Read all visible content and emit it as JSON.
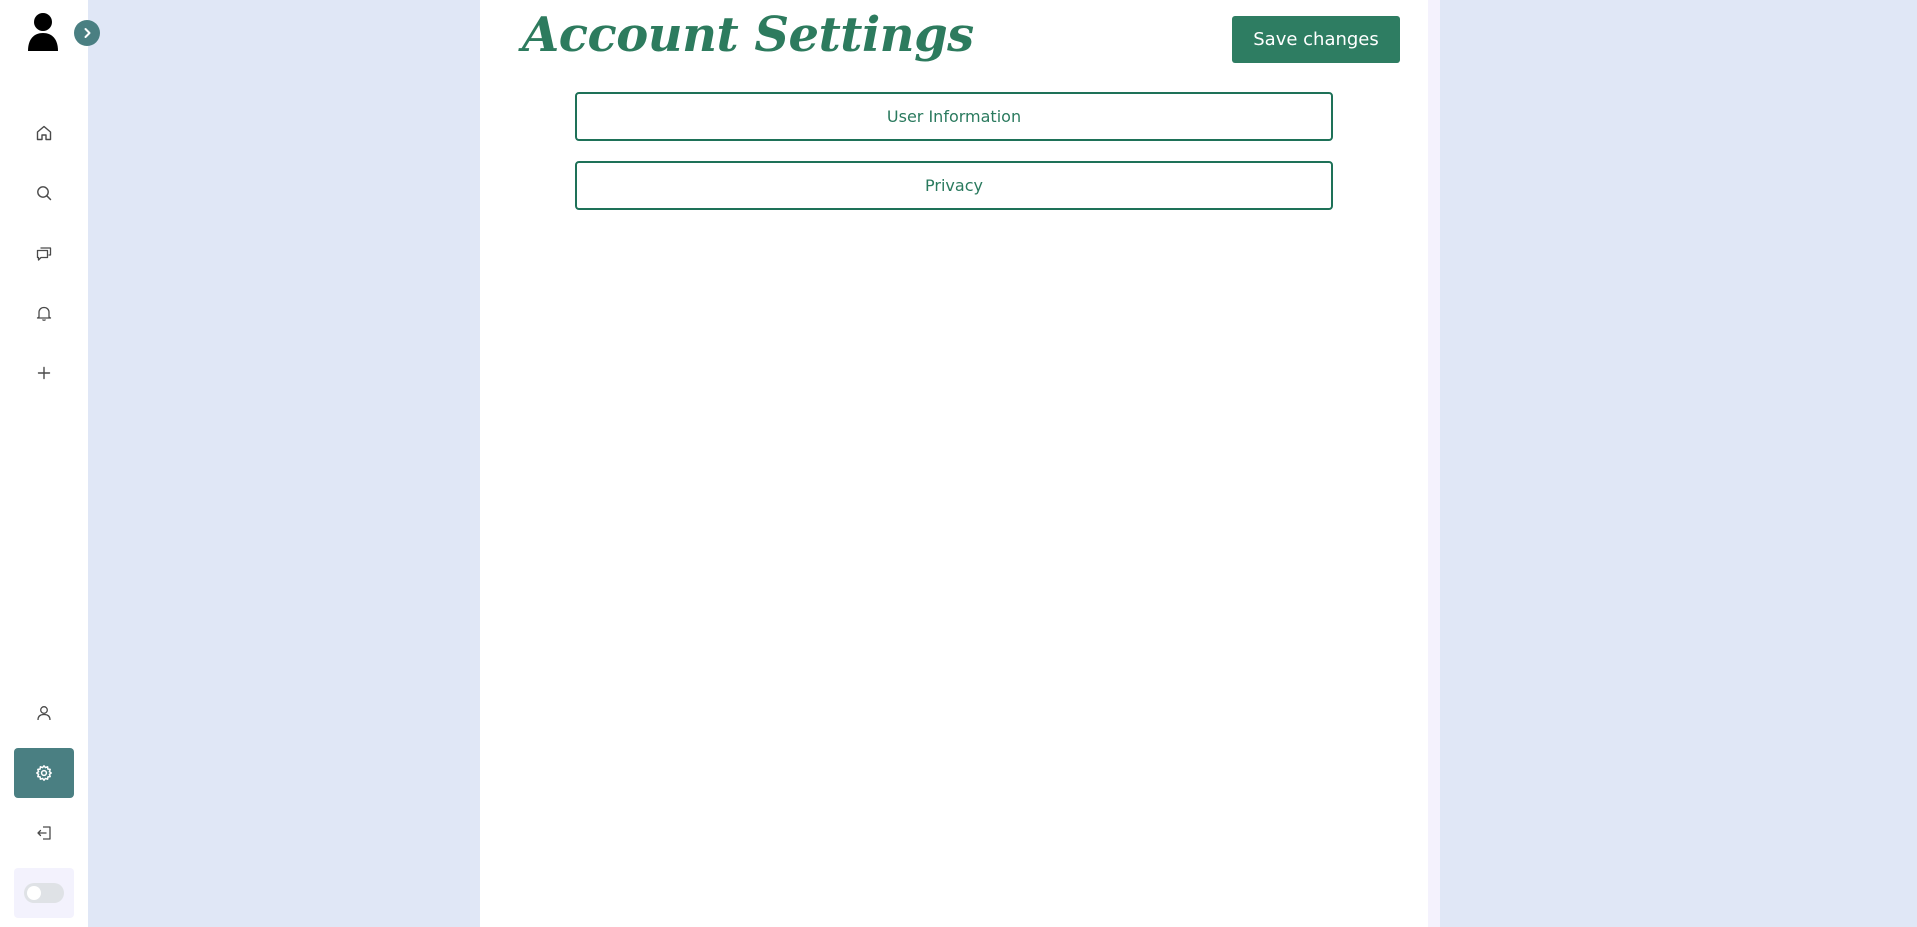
{
  "sidebar": {
    "items": [
      {
        "name": "home",
        "icon": "home-icon"
      },
      {
        "name": "search",
        "icon": "search-icon"
      },
      {
        "name": "messages",
        "icon": "chat-icon"
      },
      {
        "name": "notifications",
        "icon": "bell-icon"
      },
      {
        "name": "create",
        "icon": "plus-icon"
      },
      {
        "name": "profile",
        "icon": "user-icon"
      },
      {
        "name": "settings",
        "icon": "gear-icon",
        "active": true
      },
      {
        "name": "logout",
        "icon": "logout-icon"
      }
    ],
    "theme_toggle": {
      "on": false
    }
  },
  "header": {
    "title": "Account Settings",
    "save_label": "Save changes"
  },
  "sections": [
    {
      "label": "User Information"
    },
    {
      "label": "Privacy"
    }
  ],
  "colors": {
    "accent": "#2e7d62",
    "sidebar_active": "#4a7f82",
    "background": "#e0e7f6"
  }
}
